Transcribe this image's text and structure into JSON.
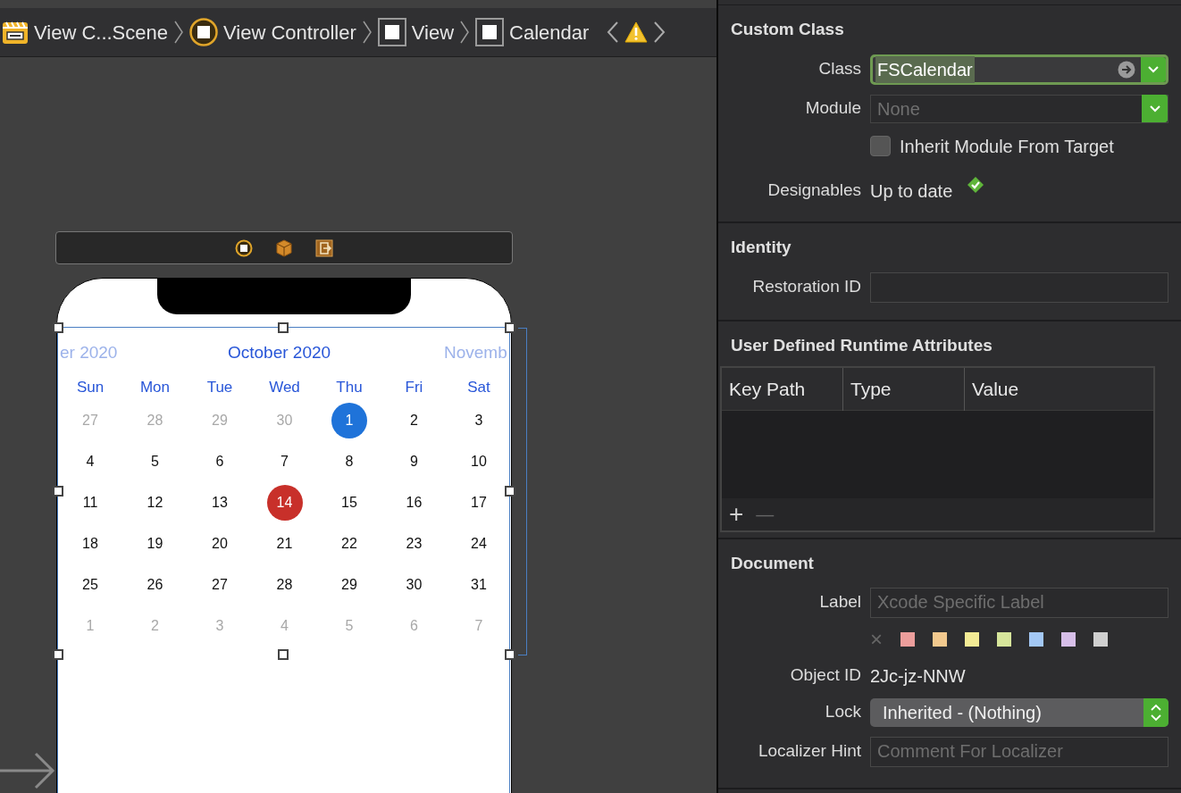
{
  "breadcrumb": [
    {
      "label": "View C...Scene"
    },
    {
      "label": "View Controller"
    },
    {
      "label": "View"
    },
    {
      "label": "Calendar"
    }
  ],
  "calendar": {
    "prev_month": "er 2020",
    "month": "October 2020",
    "next_month": "Novemb",
    "weekdays": [
      "Sun",
      "Mon",
      "Tue",
      "Wed",
      "Thu",
      "Fri",
      "Sat"
    ],
    "days": [
      {
        "text": "27",
        "kind": "outside",
        "selected": false,
        "today": false
      },
      {
        "text": "28",
        "kind": "outside",
        "selected": false,
        "today": false
      },
      {
        "text": "29",
        "kind": "outside",
        "selected": false,
        "today": false
      },
      {
        "text": "30",
        "kind": "outside",
        "selected": false,
        "today": false
      },
      {
        "text": "1",
        "kind": "month",
        "selected": true,
        "today": false
      },
      {
        "text": "2",
        "kind": "month",
        "selected": false,
        "today": false
      },
      {
        "text": "3",
        "kind": "month",
        "selected": false,
        "today": false
      },
      {
        "text": "4",
        "kind": "month",
        "selected": false,
        "today": false
      },
      {
        "text": "5",
        "kind": "month",
        "selected": false,
        "today": false
      },
      {
        "text": "6",
        "kind": "month",
        "selected": false,
        "today": false
      },
      {
        "text": "7",
        "kind": "month",
        "selected": false,
        "today": false
      },
      {
        "text": "8",
        "kind": "month",
        "selected": false,
        "today": false
      },
      {
        "text": "9",
        "kind": "month",
        "selected": false,
        "today": false
      },
      {
        "text": "10",
        "kind": "month",
        "selected": false,
        "today": false
      },
      {
        "text": "11",
        "kind": "month",
        "selected": false,
        "today": false
      },
      {
        "text": "12",
        "kind": "month",
        "selected": false,
        "today": false
      },
      {
        "text": "13",
        "kind": "month",
        "selected": false,
        "today": false
      },
      {
        "text": "14",
        "kind": "month",
        "selected": false,
        "today": true
      },
      {
        "text": "15",
        "kind": "month",
        "selected": false,
        "today": false
      },
      {
        "text": "16",
        "kind": "month",
        "selected": false,
        "today": false
      },
      {
        "text": "17",
        "kind": "month",
        "selected": false,
        "today": false
      },
      {
        "text": "18",
        "kind": "month",
        "selected": false,
        "today": false
      },
      {
        "text": "19",
        "kind": "month",
        "selected": false,
        "today": false
      },
      {
        "text": "20",
        "kind": "month",
        "selected": false,
        "today": false
      },
      {
        "text": "21",
        "kind": "month",
        "selected": false,
        "today": false
      },
      {
        "text": "22",
        "kind": "month",
        "selected": false,
        "today": false
      },
      {
        "text": "23",
        "kind": "month",
        "selected": false,
        "today": false
      },
      {
        "text": "24",
        "kind": "month",
        "selected": false,
        "today": false
      },
      {
        "text": "25",
        "kind": "month",
        "selected": false,
        "today": false
      },
      {
        "text": "26",
        "kind": "month",
        "selected": false,
        "today": false
      },
      {
        "text": "27",
        "kind": "month",
        "selected": false,
        "today": false
      },
      {
        "text": "28",
        "kind": "month",
        "selected": false,
        "today": false
      },
      {
        "text": "29",
        "kind": "month",
        "selected": false,
        "today": false
      },
      {
        "text": "30",
        "kind": "month",
        "selected": false,
        "today": false
      },
      {
        "text": "31",
        "kind": "month",
        "selected": false,
        "today": false
      },
      {
        "text": "1",
        "kind": "outside",
        "selected": false,
        "today": false
      },
      {
        "text": "2",
        "kind": "outside",
        "selected": false,
        "today": false
      },
      {
        "text": "3",
        "kind": "outside",
        "selected": false,
        "today": false
      },
      {
        "text": "4",
        "kind": "outside",
        "selected": false,
        "today": false
      },
      {
        "text": "5",
        "kind": "outside",
        "selected": false,
        "today": false
      },
      {
        "text": "6",
        "kind": "outside",
        "selected": false,
        "today": false
      },
      {
        "text": "7",
        "kind": "outside",
        "selected": false,
        "today": false
      }
    ]
  },
  "inspector": {
    "custom_class": {
      "title": "Custom Class",
      "class_label": "Class",
      "class_value": "FSCalendar",
      "module_label": "Module",
      "module_placeholder": "None",
      "inherit_label": "Inherit Module From Target",
      "inherit_checked": false,
      "designables_label": "Designables",
      "designables_value": "Up to date"
    },
    "identity": {
      "title": "Identity",
      "restoration_label": "Restoration ID"
    },
    "runtime_attributes": {
      "title": "User Defined Runtime Attributes",
      "columns": [
        "Key Path",
        "Type",
        "Value"
      ],
      "add": "+",
      "remove": "—"
    },
    "document": {
      "title": "Document",
      "label_label": "Label",
      "label_placeholder": "Xcode Specific Label",
      "clear": "×",
      "colors": [
        {
          "color": "#ec9e9c"
        },
        {
          "color": "#f2c98e"
        },
        {
          "color": "#f3eb95"
        },
        {
          "color": "#d6e59b"
        },
        {
          "color": "#a3c8f5"
        },
        {
          "color": "#d7bfe9"
        },
        {
          "color": "#d0d0d0"
        }
      ],
      "object_id_label": "Object ID",
      "object_id": "2Jc-jz-NNW",
      "lock_label": "Lock",
      "lock_value": "Inherited - (Nothing)",
      "hint_label": "Localizer Hint",
      "hint_placeholder": "Comment For Localizer"
    }
  }
}
